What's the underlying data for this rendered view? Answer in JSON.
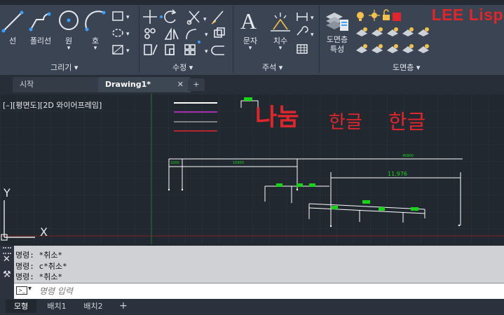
{
  "ribbon": {
    "tools_draw": {
      "line": "선",
      "polyline": "폴리선",
      "circle": "원",
      "arc": "호"
    },
    "panel_draw": "그리기",
    "panel_modify": "수정",
    "tools_annot": {
      "text": "문자",
      "dim": "치수"
    },
    "panel_annot": "주석",
    "tools_layer": {
      "layer_props": "도면층\n특성"
    },
    "panel_layer": "도면층",
    "overlay_lisp": "LEE Lisp"
  },
  "tabs": {
    "start": "시작",
    "drawing": "Drawing1*"
  },
  "viewport": {
    "label": "[–][평면도][2D 와이어프레임]"
  },
  "drawing": {
    "big_text": "나눔",
    "thin_text_1": "한글",
    "thin_text_2": "한글",
    "dims": {
      "d1": "1000",
      "d2": "10900",
      "d3": "45800",
      "d4": "11,976"
    },
    "ucs_y": "Y",
    "ucs_x": "X"
  },
  "command": {
    "history": [
      "명령: *취소*",
      "명령: c*취소*",
      "명령: *취소*"
    ],
    "placeholder": "명령 입력"
  },
  "layout_tabs": [
    "모형",
    "배치1",
    "배치2"
  ],
  "colors": {
    "ribbon": "#3b4453",
    "canvas": "#212830",
    "accent_red": "#e0262a",
    "dim_green": "#17d417"
  }
}
